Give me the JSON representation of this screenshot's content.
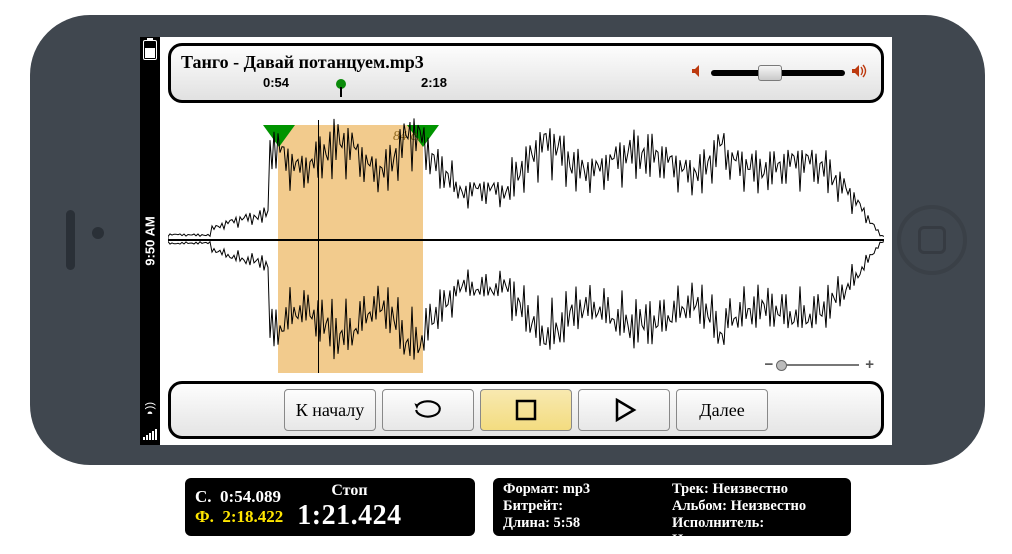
{
  "statusbar": {
    "clock": "9:50 AM"
  },
  "header": {
    "filename": "Танго - Давай потанцуем.mp3",
    "selection_start": "0:54",
    "selection_end": "2:18",
    "selection_duration_label": "84 с."
  },
  "controls": {
    "to_start": "К началу",
    "next": "Далее"
  },
  "footer": {
    "c_label_prefix": "С.",
    "c_time": "0:54.089",
    "f_label_prefix": "Ф.",
    "f_time": "2:18.422",
    "state_label": "Стоп",
    "big_time": "1:21.424",
    "format_label": "Формат:",
    "format_value": "mp3",
    "bitrate_label": "Битрейт:",
    "length_label": "Длина:",
    "length_value": "5:58",
    "track_label": "Трек:",
    "track_value": "Неизвестно",
    "album_label": "Альбом:",
    "album_value": "Неизвестно",
    "artist_label": "Исполнитель:",
    "artist_value": "Неизвестно"
  }
}
